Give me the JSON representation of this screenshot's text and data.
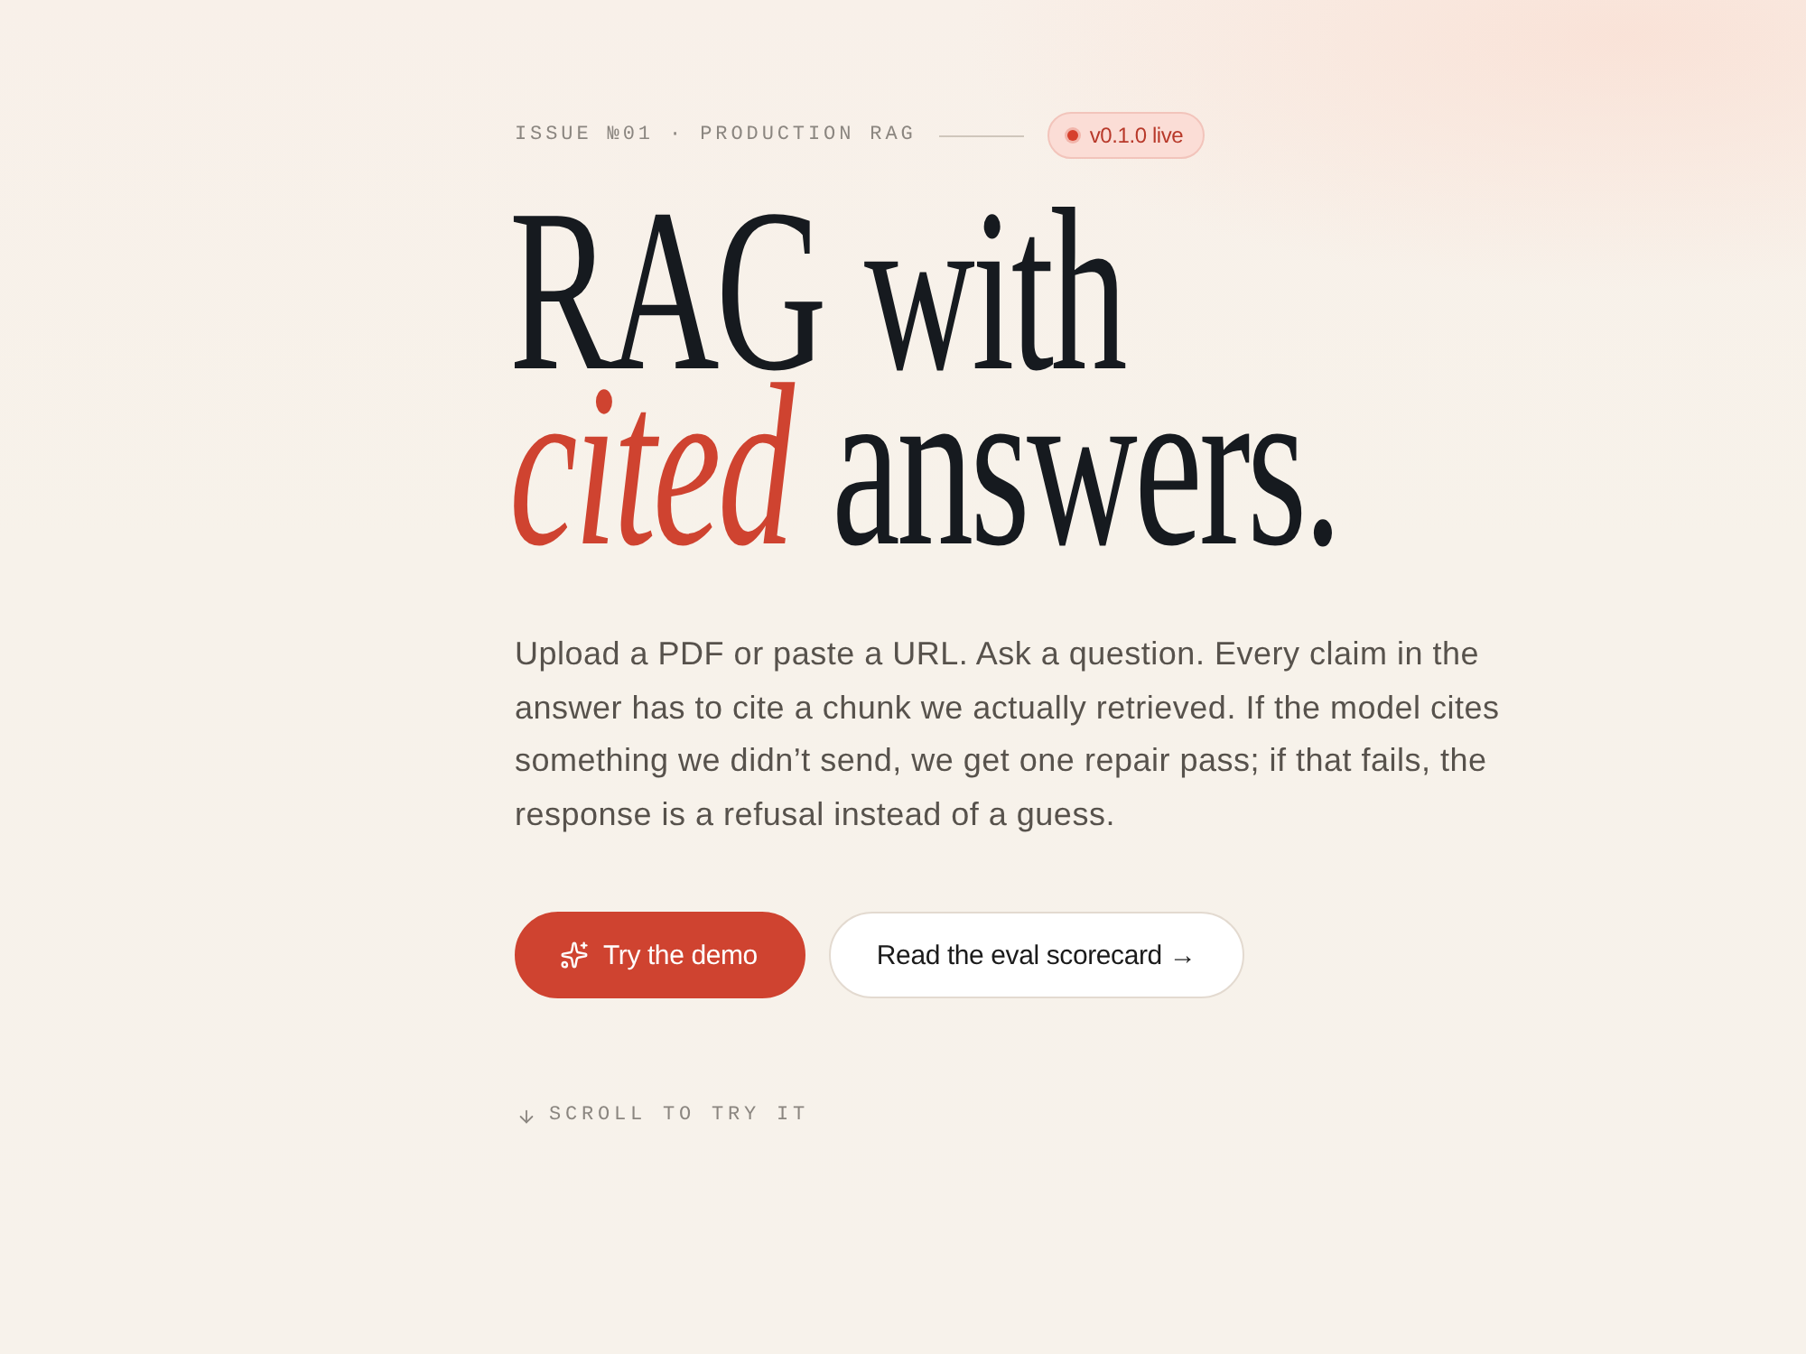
{
  "eyebrow": {
    "label": "ISSUE №01 · PRODUCTION RAG",
    "badge": "v0.1.0 live"
  },
  "headline": {
    "lines": [
      "RAG with",
      "*cited* answers."
    ]
  },
  "intro": "Upload a PDF or paste a URL. Ask a question. Every claim in the answer has to cite a chunk we actually retrieved. If the model cites something we didn’t send, we get one repair pass; if that fails, the response is a refusal instead of a guess.",
  "actions": [
    {
      "label": "Try the demo",
      "kind": "primary"
    },
    {
      "label": "Read the eval scorecard →",
      "kind": "secondary"
    }
  ],
  "scroll_hint": "SCROLL TO TRY IT"
}
